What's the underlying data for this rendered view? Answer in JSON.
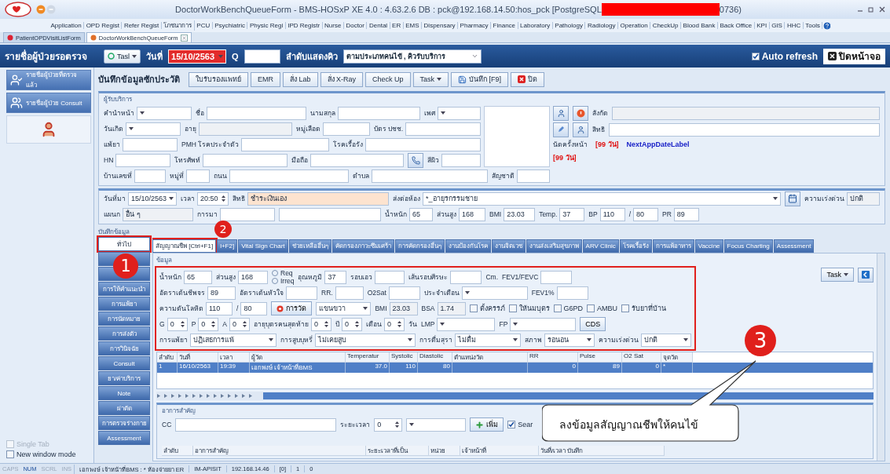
{
  "window": {
    "title": "DoctorWorkBenchQueueForm - BMS-HOSxP XE 4.0 : 4.63.2.6 DB : pck@192.168.14.50:hos_pck [PostgreSQL",
    "title_tail": "0736)"
  },
  "menu": [
    "Application",
    "OPD Regist",
    "Refer Regist",
    "โภชนาการ",
    "PCU",
    "Psychiatric",
    "Physic Regi",
    "IPD Registr",
    "Nurse",
    "Doctor",
    "Dental",
    "ER",
    "EMS",
    "Dispensary",
    "Pharmacy",
    "Finance",
    "Laboratory",
    "Pathology",
    "Radiology",
    "Operation",
    "CheckUp",
    "Blood Bank",
    "Back Office",
    "KPI",
    "GIS",
    "HHC",
    "Tools"
  ],
  "doc_tabs": [
    {
      "label": "PatientOPDVisitListForm",
      "selected": false
    },
    {
      "label": "DoctorWorkBenchQueueForm",
      "selected": true
    }
  ],
  "queue_bar": {
    "title": "รายชื่อผู้ป่วยรอตรวจ",
    "task": "Tasl",
    "date_label": "วันที่",
    "date": "15/10/2563",
    "q_label": "Q",
    "order_label": "ลำดับแสดงคิว",
    "order_value": "ตามประเภทคนไข้ , คิวรับบริการ",
    "auto_refresh": {
      "label": "Auto refresh",
      "checked": true
    },
    "close": "ปิดหน้าจอ"
  },
  "sidebar": {
    "items": [
      {
        "label": "รายชื่อผู้ป่วยที่ตรวจแล้ว"
      },
      {
        "label": "รายชื่อผู้ป่วย Consult"
      }
    ],
    "options": [
      {
        "label": "Single Tab",
        "checked": false,
        "disabled": true
      },
      {
        "label": "New window mode",
        "checked": false,
        "disabled": false
      }
    ]
  },
  "toolbar": {
    "title": "บันทึกข้อมูลซักประวัติ",
    "buttons": [
      {
        "kind": "plain",
        "label": "ใบรับรองแพทย์"
      },
      {
        "kind": "plain",
        "label": "EMR"
      },
      {
        "kind": "plain",
        "label": "สั่ง Lab"
      },
      {
        "kind": "plain",
        "label": "สั่ง X-Ray"
      },
      {
        "kind": "plain",
        "label": "Check Up"
      },
      {
        "kind": "menu",
        "label": "Task"
      },
      {
        "kind": "save",
        "label": "บันทึก [F9]"
      },
      {
        "kind": "close",
        "label": "ปิด"
      }
    ]
  },
  "patient": {
    "title": "ผู้รับบริการ",
    "rows": [
      [
        {
          "kind": "combo",
          "label": "คำนำหน้า"
        },
        {
          "kind": "field",
          "label": "ชื่อ"
        },
        {
          "kind": "field",
          "label": "นามสกุล"
        },
        {
          "kind": "combo",
          "label": "เพศ"
        }
      ],
      [
        {
          "kind": "combo",
          "label": "วันเกิด"
        },
        {
          "kind": "field",
          "label": "อายุ",
          "readonly": true
        },
        {
          "kind": "field",
          "label": "หมู่เลือด"
        },
        {
          "kind": "field",
          "label": "บัตร ปชช."
        }
      ],
      [
        {
          "kind": "field",
          "label": "แพ้ยา"
        },
        {
          "kind": "field",
          "label": "PMH โรคประจำตัว"
        },
        {
          "kind": "field",
          "label": "โรคเรื้อรัง"
        }
      ],
      [
        {
          "kind": "field",
          "label": "HN"
        },
        {
          "kind": "field",
          "label": "โทรศัพท์"
        },
        {
          "kind": "field",
          "label": "มือถือ"
        },
        {
          "kind": "phone_button"
        },
        {
          "kind": "field",
          "label": "สีผิว"
        }
      ],
      [
        {
          "kind": "field",
          "label": "บ้านเลขที่"
        },
        {
          "kind": "field",
          "label": "หมู่ที่"
        },
        {
          "kind": "field",
          "label": "ถนน"
        },
        {
          "kind": "field",
          "label": "ตำบล"
        },
        {
          "kind": "field",
          "label": "สัญชาติ"
        }
      ]
    ],
    "affiliation": {
      "label": "สังกัด"
    },
    "rights": {
      "label": "สิทธิ"
    },
    "next_appointment": {
      "label": "นัดครั้งหน้า",
      "days": "[99 วัน]",
      "date": "NextAppDateLabel",
      "days_2": "[99 วัน]"
    }
  },
  "visit": {
    "rows": [
      [
        {
          "kind": "combo",
          "label": "วันที่มา",
          "value": "15/10/2563"
        },
        {
          "kind": "spin",
          "label": "เวลา",
          "value": "20:50"
        },
        {
          "kind": "field",
          "label": "สิทธิ",
          "value": "ชำระเงินเอง",
          "highlighted": true
        },
        {
          "kind": "combo",
          "label": "ส่งต่อห้อง",
          "value": "*_อายุรกรรมชาย"
        },
        {
          "kind": "calendar_button"
        },
        {
          "kind": "field",
          "label": "ความเร่งด่วน",
          "value": "ปกติ",
          "readonly": true
        }
      ],
      [
        {
          "kind": "field",
          "label": "แผนก",
          "value": "อื่น ๆ",
          "readonly": true
        },
        {
          "kind": "field",
          "label": "การมา"
        },
        {
          "kind": "field"
        },
        {
          "kind": "field",
          "label": "น้ำหนัก",
          "value": "65"
        },
        {
          "kind": "field",
          "label": "ส่วนสูง",
          "value": "168"
        },
        {
          "kind": "field",
          "label": "BMI",
          "value": "23.03"
        },
        {
          "kind": "field",
          "label": "Temp.",
          "value": "37"
        },
        {
          "kind": "field",
          "label": "BP",
          "value": "110"
        },
        {
          "kind": "field",
          "label": "/",
          "value": "80"
        },
        {
          "kind": "field",
          "label": "PR",
          "value": "89"
        }
      ]
    ]
  },
  "record": {
    "title": "บันทึกข้อมูล",
    "side_tabs": [
      {
        "label": "ทั่วไป",
        "selected": true,
        "highlighted": true
      },
      {
        "selected": false
      },
      {
        "selected": false
      },
      {
        "label": "การให้คำแนะนำ",
        "selected": false
      },
      {
        "label": "การแพ้ยา",
        "selected": false
      },
      {
        "label": "การนัดหมาย",
        "selected": false
      },
      {
        "label": "การส่งตัว",
        "selected": false
      },
      {
        "label": "การวินิจฉัย",
        "selected": false
      },
      {
        "label": "Consult",
        "selected": false
      },
      {
        "label": "ยา/ค่าบริการ",
        "selected": false
      },
      {
        "label": "Note",
        "selected": false
      },
      {
        "label": "ผ่าตัด",
        "selected": false
      },
      {
        "label": "การตรวจร่างกาย",
        "selected": false
      },
      {
        "label": "Assessment",
        "selected": false
      }
    ],
    "tabs": [
      {
        "label": "สัญญาณชีพ [Ctrl+F1]",
        "selected": true,
        "highlighted": true
      },
      {
        "label": "l+F2]",
        "selected": false
      },
      {
        "label": "Vital Sign Chart",
        "selected": false
      },
      {
        "label": "ช่วยเหลืออื่นๆ",
        "selected": false
      },
      {
        "label": "คัดกรองภาวะซึมเศร้า",
        "selected": false
      },
      {
        "label": "การคัดกรองอื่นๆ",
        "selected": false
      },
      {
        "label": "งานป้องกันโรค",
        "selected": false
      },
      {
        "label": "งานจิตเวช",
        "selected": false
      },
      {
        "label": "งานส่งเสริมสุขภาพ",
        "selected": false
      },
      {
        "label": "ARV Clinic",
        "selected": false
      },
      {
        "label": "โรคเรื้อรัง",
        "selected": false
      },
      {
        "label": "การแพ้อาหาร",
        "selected": false
      },
      {
        "label": "Vaccine",
        "selected": false
      },
      {
        "label": "Focus Charting",
        "selected": false
      },
      {
        "label": "Assessment",
        "selected": false
      }
    ],
    "form_title": "ข้อมูล",
    "form_highlighted": true,
    "task": "Task",
    "form_rows": [
      [
        {
          "kind": "field",
          "label": "น้ำหนัก",
          "value": "65"
        },
        {
          "kind": "field",
          "label": "ส่วนสูง",
          "value": "168"
        },
        {
          "kind": "radio",
          "options": [
            {
              "label": "Req",
              "selected": false
            },
            {
              "label": "Irreq",
              "selected": false
            }
          ]
        },
        {
          "kind": "field",
          "label": "อุณหภูมิ",
          "value": "37"
        },
        {
          "kind": "field",
          "label": "รอบเอว"
        },
        {
          "kind": "field",
          "label": "เส้นรอบศีรษะ"
        },
        {
          "kind": "text",
          "text": "Cm."
        },
        {
          "kind": "field",
          "label": "FEV1/FEVC"
        }
      ],
      [
        {
          "kind": "field",
          "label": "อัตราเต้นชีพจร",
          "value": "89"
        },
        {
          "kind": "field",
          "label": "อัตราเต้นหัวใจ"
        },
        {
          "kind": "field",
          "label": "RR."
        },
        {
          "kind": "field",
          "label": "O2Sat"
        },
        {
          "kind": "combo",
          "label": "ประจำเดือน"
        },
        {
          "kind": "field",
          "label": "FEV1%"
        }
      ],
      [
        {
          "kind": "field",
          "label": "ความดันโลหิต",
          "value": "110"
        },
        {
          "kind": "field",
          "label": "/",
          "value": "80"
        },
        {
          "kind": "measure_button",
          "label": "การวัด"
        },
        {
          "kind": "combo",
          "value": "แขนขวา"
        },
        {
          "kind": "field",
          "label": "BMI",
          "value": "23.03",
          "readonly": true
        },
        {
          "kind": "field",
          "label": "BSA",
          "value": "1.74",
          "readonly": true
        },
        {
          "kind": "check",
          "label": "ตั้งครรภ์",
          "checked": false
        },
        {
          "kind": "check",
          "label": "ให้นมบุตร",
          "checked": false
        },
        {
          "kind": "check",
          "label": "G6PD",
          "checked": false
        },
        {
          "kind": "check",
          "label": "AMBU",
          "checked": false
        },
        {
          "kind": "check",
          "label": "รับยาที่บ้าน",
          "checked": false
        }
      ],
      [
        {
          "kind": "spin",
          "label": "G",
          "value": "0"
        },
        {
          "kind": "spin",
          "label": "P",
          "value": "0"
        },
        {
          "kind": "spin",
          "label": "A",
          "value": "0"
        },
        {
          "kind": "spin",
          "label": "อายุบุตรคนสุดท้าย",
          "value": "0"
        },
        {
          "kind": "spin",
          "label": "ปี",
          "value": "0"
        },
        {
          "kind": "spin",
          "label": "เดือน",
          "value": "0"
        },
        {
          "kind": "text",
          "text": "วัน"
        },
        {
          "kind": "combo",
          "label": "LMP"
        },
        {
          "kind": "combo",
          "label": "FP"
        },
        {
          "kind": "button",
          "label": "CDS"
        }
      ],
      [
        {
          "kind": "combo",
          "label": "การแพ้ยา",
          "value": "ปฏิเสธการแพ้"
        },
        {
          "kind": "combo",
          "label": "การสูบบุหรี่",
          "value": "ไม่เคยสูบ"
        },
        {
          "kind": "combo",
          "label": "การดื่มสุรา",
          "value": "ไม่ดื่ม"
        },
        {
          "kind": "combo",
          "label": "สภาพ",
          "value": "รอนอน"
        },
        {
          "kind": "combo",
          "label": "ความเร่งด่วน",
          "value": "ปกติ"
        }
      ]
    ],
    "table": {
      "columns": [
        "ลำดับ",
        "วันที่",
        "เวลา",
        "ผู้วัด",
        "Temperatur",
        "Systolic",
        "Diastolic",
        "ตำแหน่งวัด",
        "RR",
        "Pulse",
        "O2 Sat",
        "จุดวัด"
      ],
      "rows": [
        {
          "selected": true,
          "cells": [
            "1",
            "16/10/2563",
            "19:39",
            "เอกพงษ์ เจ้าหน้าที่BMS",
            "37.0",
            "110",
            "80",
            null,
            "0",
            "89",
            "0",
            "*"
          ]
        }
      ]
    },
    "complaint": {
      "title": "อาการสำคัญ",
      "cc_label": "CC",
      "duration_label": "ระยะเวลา",
      "duration": "0",
      "add_button": "เพิ่ม",
      "search": {
        "label": "Sear",
        "checked": true
      },
      "columns": [
        "ลำดับ",
        "อาการสำคัญ",
        "ระยะเวลาที่เป็น",
        "หน่วย",
        "เจ้าหน้าที่",
        "วันที่/เวลา บันทึก"
      ]
    }
  },
  "status_bar": {
    "keys": [
      {
        "label": "CAPS",
        "on": false
      },
      {
        "label": "NUM",
        "on": true
      },
      {
        "label": "SCRL",
        "on": false
      },
      {
        "label": "INS",
        "on": false
      }
    ],
    "cells": [
      "เอกพงษ์ เจ้าหน้าที่BMS : * ห้องจ่ายยา ER",
      "IM-APISIT",
      "192.168.14.46",
      "[0]",
      "1",
      "0"
    ]
  },
  "annotations": {
    "markers": [
      "1",
      "2",
      "3"
    ],
    "callout": "ลงข้อมูลสัญญาณชีพให้คนไข้"
  }
}
